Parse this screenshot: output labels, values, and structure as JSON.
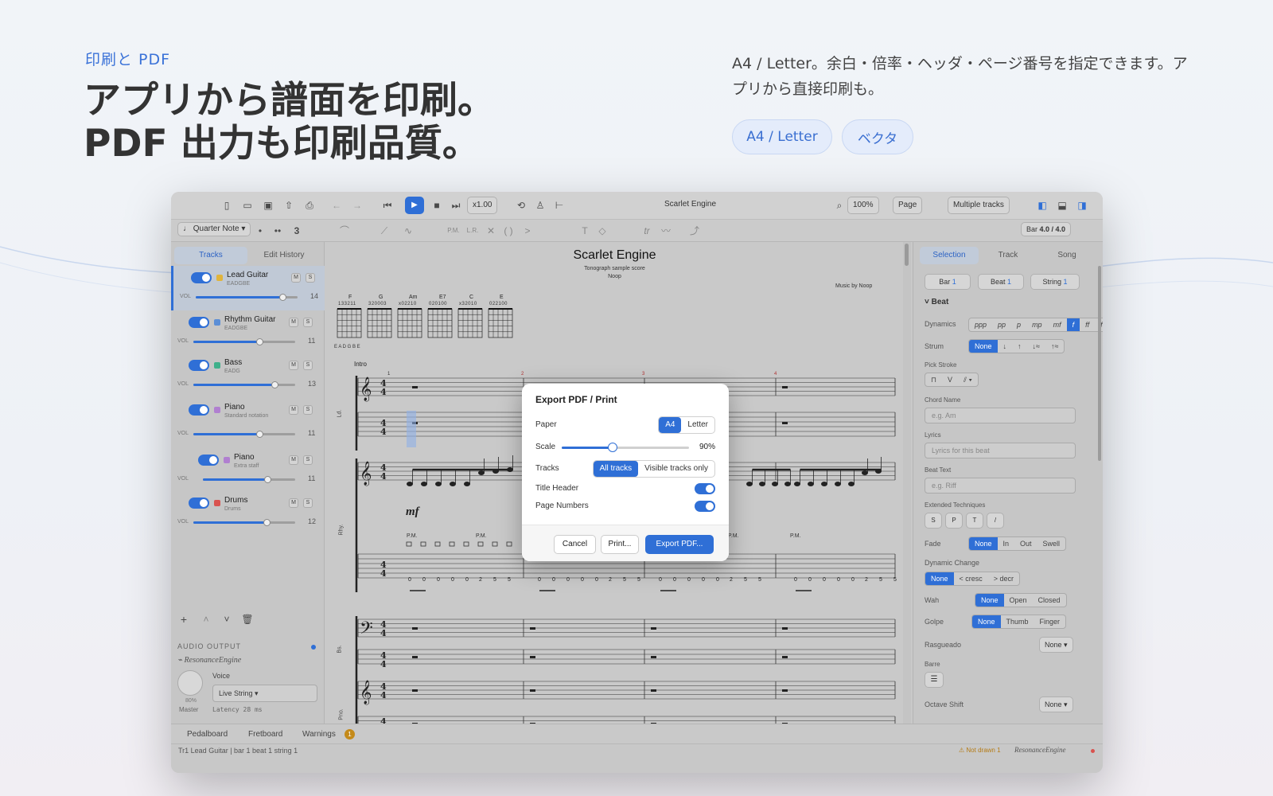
{
  "hero": {
    "eyebrow": "印刷と PDF",
    "title_line1": "アプリから譜面を印刷。",
    "title_line2": "PDF 出力も印刷品質。",
    "description": "A4 / Letter。余白・倍率・ヘッダ・ページ番号を指定できます。アプリから直接印刷も。",
    "pills": [
      "A4 / Letter",
      "ベクタ"
    ]
  },
  "app": {
    "window_title": "Scarlet Engine",
    "speed": "x1.00",
    "zoom": "100%",
    "view_mode": "Page",
    "track_mode": "Multiple tracks",
    "note_value": "Quarter Note",
    "tuplet": "3",
    "bar_label": "Bar",
    "bar_value": "4.0 / 4.0",
    "toolbar2_text": [
      "P.M.",
      "L.R.",
      "T",
      "tr"
    ]
  },
  "left_panel": {
    "tabs": [
      "Tracks",
      "Edit History"
    ],
    "tracks": [
      {
        "name": "Lead Guitar",
        "sub": "EADGBE",
        "value": "14",
        "color": "#e0b43c",
        "level": 0.85
      },
      {
        "name": "Rhythm Guitar",
        "sub": "EADGBE",
        "value": "11",
        "color": "#5b8ed6",
        "level": 0.65
      },
      {
        "name": "Bass",
        "sub": "EADG",
        "value": "13",
        "color": "#3fb08a",
        "level": 0.8
      },
      {
        "name": "Piano",
        "sub": "Standard notation",
        "value": "11",
        "color": "#b07fd0",
        "level": 0.65
      },
      {
        "name": "Piano",
        "sub": "Extra staff",
        "value": "11",
        "color": "#b07fd0",
        "level": 0.7
      },
      {
        "name": "Drums",
        "sub": "Drums",
        "value": "12",
        "color": "#d9534f",
        "level": 0.72
      }
    ],
    "vol_label": "VOL",
    "audio_output_label": "AUDIO OUTPUT",
    "engine_name": "ResonanceEngine",
    "voice_label": "Voice",
    "voice_value": "Live String",
    "latency": "Latency 28 ms",
    "master_percent": "80%",
    "master_label": "Master"
  },
  "score": {
    "title": "Scarlet Engine",
    "subtitle": "Tonograph sample score",
    "author": "Noop",
    "music_by": "Music by Noop",
    "chords": [
      "F",
      "G",
      "Am",
      "E7",
      "C",
      "E"
    ],
    "chord_fingerings": [
      "133211",
      "320003",
      "x02210",
      "020100",
      "x32010",
      "022100"
    ],
    "tuning_text": "E A D G B E",
    "section": "Intro",
    "track_labels": [
      "Ld.",
      "Rhy.",
      "Bs.",
      "Pno."
    ],
    "bar_numbers": [
      "1",
      "2",
      "3",
      "4"
    ],
    "dynamic_mark": "mf",
    "pm_text": "P.M."
  },
  "dialog": {
    "title": "Export PDF / Print",
    "paper_label": "Paper",
    "paper_options": [
      "A4",
      "Letter"
    ],
    "scale_label": "Scale",
    "scale_value": "90%",
    "scale_level": 0.4,
    "tracks_label": "Tracks",
    "tracks_options": [
      "All tracks",
      "Visible tracks only"
    ],
    "title_header_label": "Title Header",
    "page_numbers_label": "Page Numbers",
    "cancel": "Cancel",
    "print": "Print...",
    "export": "Export PDF..."
  },
  "right_panel": {
    "tabs": [
      "Selection",
      "Track",
      "Song"
    ],
    "selectors": [
      {
        "label": "Bar",
        "value": "1"
      },
      {
        "label": "Beat",
        "value": "1"
      },
      {
        "label": "String",
        "value": "1"
      }
    ],
    "section": "Beat",
    "dynamics_label": "Dynamics",
    "dynamics": [
      "ppp",
      "pp",
      "p",
      "mp",
      "mf",
      "f",
      "ff",
      "fff"
    ],
    "strum_label": "Strum",
    "strum_options": [
      "None",
      "↓",
      "↑",
      "↓≈",
      "↑≈"
    ],
    "pick_stroke_label": "Pick Stroke",
    "chord_name_label": "Chord Name",
    "chord_name_placeholder": "e.g. Am",
    "lyrics_label": "Lyrics",
    "lyrics_placeholder": "Lyrics for this beat",
    "beat_text_label": "Beat Text",
    "beat_text_placeholder": "e.g. Riff",
    "ext_tech_label": "Extended Techniques",
    "ext_tech": [
      "S",
      "P",
      "T",
      "/"
    ],
    "fade_label": "Fade",
    "fade_options": [
      "None",
      "In",
      "Out",
      "Swell"
    ],
    "dyn_change_label": "Dynamic Change",
    "dyn_change_options": [
      "None",
      "< cresc",
      "> decr"
    ],
    "wah_label": "Wah",
    "wah_options": [
      "None",
      "Open",
      "Closed"
    ],
    "golpe_label": "Golpe",
    "golpe_options": [
      "None",
      "Thumb",
      "Finger"
    ],
    "rasgueado_label": "Rasgueado",
    "rasgueado_value": "None",
    "barre_label": "Barre",
    "octave_label": "Octave Shift",
    "octave_value": "None"
  },
  "bottom_tabs": [
    "Pedalboard",
    "Fretboard",
    "Warnings"
  ],
  "warnings_count": "1",
  "status": {
    "left": "Tr1 Lead Guitar | bar 1 beat 1 string 1",
    "not_drawn": "Not drawn 1",
    "engine": "ResonanceEngine"
  }
}
